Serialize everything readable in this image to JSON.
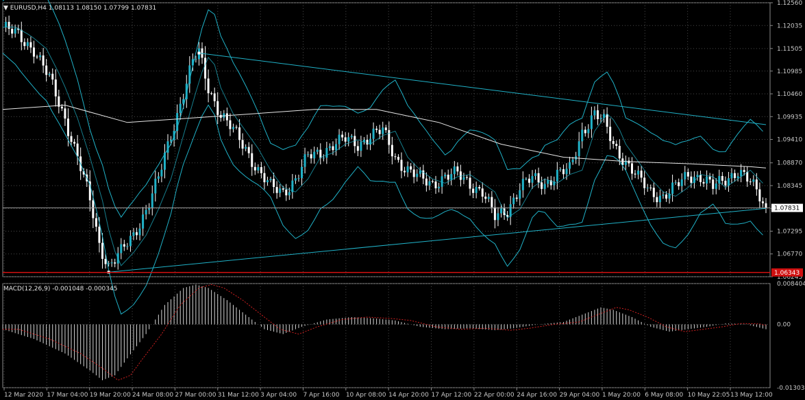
{
  "header": {
    "symbol_line": "EURUSD,H4  1.08113 1.08150 1.07799 1.07831",
    "macd_line": "MACD(12,26,9) -0.001048 -0.000345"
  },
  "colors": {
    "background": "#000000",
    "grid": "#4a4a4a",
    "candle": "#ffffff",
    "accent": "#20b2c8",
    "ma_long": "#e8e8e8",
    "signal": "#d02020",
    "support_line": "#d01010"
  },
  "chart_data": [
    {
      "type": "candlestick",
      "symbol": "EURUSD",
      "timeframe": "H4",
      "ohlc_last": {
        "open": 1.08113,
        "high": 1.0815,
        "low": 1.07799,
        "close": 1.07831
      },
      "ylim": [
        1.06245,
        1.1256
      ],
      "y_ticks": [
        "1.12560",
        "1.12035",
        "1.11505",
        "1.10985",
        "1.10460",
        "1.09935",
        "1.09410",
        "1.08870",
        "1.08345",
        "1.07820",
        "1.07295",
        "1.06770",
        "1.06245"
      ],
      "current_price_label": "1.07831",
      "horizontal_line_label": "1.06343",
      "horizontal_line_value": 1.06343,
      "x_tick_labels": [
        "12 Mar 2020",
        "17 Mar 04:00",
        "19 Mar 20:00",
        "24 Mar 08:00",
        "27 Mar 00:00",
        "31 Mar 12:00",
        "3 Apr 04:00",
        "7 Apr 16:00",
        "10 Apr 08:00",
        "14 Apr 20:00",
        "17 Apr 12:00",
        "22 Apr 00:00",
        "24 Apr 16:00",
        "29 Apr 04:00",
        "1 May 20:00",
        "6 May 08:00",
        "10 May 22:05",
        "13 May 12:00"
      ],
      "close_path": [
        [
          0,
          1.12
        ],
        [
          5,
          1.118
        ],
        [
          10,
          1.115
        ],
        [
          15,
          1.108
        ],
        [
          20,
          1.099
        ],
        [
          24,
          1.09
        ],
        [
          28,
          1.08
        ],
        [
          31,
          1.07
        ],
        [
          34,
          1.065
        ],
        [
          38,
          1.068
        ],
        [
          42,
          1.072
        ],
        [
          46,
          1.078
        ],
        [
          50,
          1.085
        ],
        [
          54,
          1.095
        ],
        [
          58,
          1.105
        ],
        [
          61,
          1.112
        ],
        [
          63,
          1.114
        ],
        [
          66,
          1.106
        ],
        [
          70,
          1.1
        ],
        [
          74,
          1.096
        ],
        [
          78,
          1.092
        ],
        [
          82,
          1.087
        ],
        [
          86,
          1.083
        ],
        [
          90,
          1.082
        ],
        [
          94,
          1.085
        ],
        [
          98,
          1.09
        ],
        [
          102,
          1.091
        ],
        [
          106,
          1.093
        ],
        [
          110,
          1.094
        ],
        [
          114,
          1.093
        ],
        [
          118,
          1.095
        ],
        [
          122,
          1.096
        ],
        [
          126,
          1.09
        ],
        [
          130,
          1.087
        ],
        [
          134,
          1.085
        ],
        [
          138,
          1.084
        ],
        [
          142,
          1.0855
        ],
        [
          146,
          1.086
        ],
        [
          150,
          1.084
        ],
        [
          154,
          1.082
        ],
        [
          158,
          1.076
        ],
        [
          162,
          1.078
        ],
        [
          166,
          1.083
        ],
        [
          170,
          1.085
        ],
        [
          174,
          1.084
        ],
        [
          178,
          1.086
        ],
        [
          182,
          1.087
        ],
        [
          186,
          1.096
        ],
        [
          190,
          1.1
        ],
        [
          193,
          1.098
        ],
        [
          196,
          1.093
        ],
        [
          200,
          1.089
        ],
        [
          204,
          1.085
        ],
        [
          208,
          1.082
        ],
        [
          212,
          1.081
        ],
        [
          216,
          1.083
        ],
        [
          220,
          1.086
        ],
        [
          224,
          1.0855
        ],
        [
          228,
          1.083
        ],
        [
          232,
          1.085
        ],
        [
          236,
          1.087
        ],
        [
          240,
          1.084
        ],
        [
          243,
          1.081
        ],
        [
          245,
          1.0783
        ]
      ],
      "long_ma_path": [
        [
          0,
          1.101
        ],
        [
          20,
          1.102
        ],
        [
          40,
          1.098
        ],
        [
          60,
          1.099
        ],
        [
          80,
          1.1
        ],
        [
          100,
          1.101
        ],
        [
          120,
          1.101
        ],
        [
          140,
          1.098
        ],
        [
          160,
          1.093
        ],
        [
          180,
          1.09
        ],
        [
          200,
          1.089
        ],
        [
          220,
          1.0885
        ],
        [
          240,
          1.0878
        ],
        [
          245,
          1.0875
        ]
      ],
      "trendlines": [
        {
          "name": "descending-resistance",
          "from": [
            63,
            1.114
          ],
          "to": [
            245,
            1.0975
          ]
        },
        {
          "name": "ascending-support",
          "from": [
            34,
            1.0635
          ],
          "to": [
            245,
            1.0782
          ]
        }
      ]
    },
    {
      "type": "macd",
      "title": "MACD(12,26,9)",
      "values_text": "-0.001048 -0.000345",
      "ylim": [
        -0.013033,
        0.008404
      ],
      "y_ticks": [
        "0.008404",
        "0.00",
        "-0.013033"
      ],
      "histogram_path": [
        [
          0,
          -0.001
        ],
        [
          10,
          -0.003
        ],
        [
          20,
          -0.006
        ],
        [
          28,
          -0.0095
        ],
        [
          32,
          -0.0115
        ],
        [
          36,
          -0.0105
        ],
        [
          40,
          -0.007
        ],
        [
          46,
          -0.002
        ],
        [
          52,
          0.004
        ],
        [
          58,
          0.0075
        ],
        [
          62,
          0.0082
        ],
        [
          66,
          0.0075
        ],
        [
          72,
          0.005
        ],
        [
          78,
          0.002
        ],
        [
          84,
          -0.001
        ],
        [
          90,
          -0.002
        ],
        [
          96,
          -0.0005
        ],
        [
          104,
          0.001
        ],
        [
          112,
          0.0015
        ],
        [
          120,
          0.0012
        ],
        [
          126,
          0.0008
        ],
        [
          134,
          -0.0005
        ],
        [
          142,
          -0.001
        ],
        [
          150,
          -0.0008
        ],
        [
          158,
          -0.0012
        ],
        [
          164,
          -0.0008
        ],
        [
          172,
          0.0
        ],
        [
          180,
          0.0005
        ],
        [
          186,
          0.002
        ],
        [
          192,
          0.0035
        ],
        [
          196,
          0.003
        ],
        [
          202,
          0.0015
        ],
        [
          208,
          -0.0005
        ],
        [
          214,
          -0.0015
        ],
        [
          220,
          -0.001
        ],
        [
          226,
          -0.0005
        ],
        [
          232,
          0.0002
        ],
        [
          238,
          0.0001
        ],
        [
          245,
          -0.001
        ]
      ]
    }
  ]
}
